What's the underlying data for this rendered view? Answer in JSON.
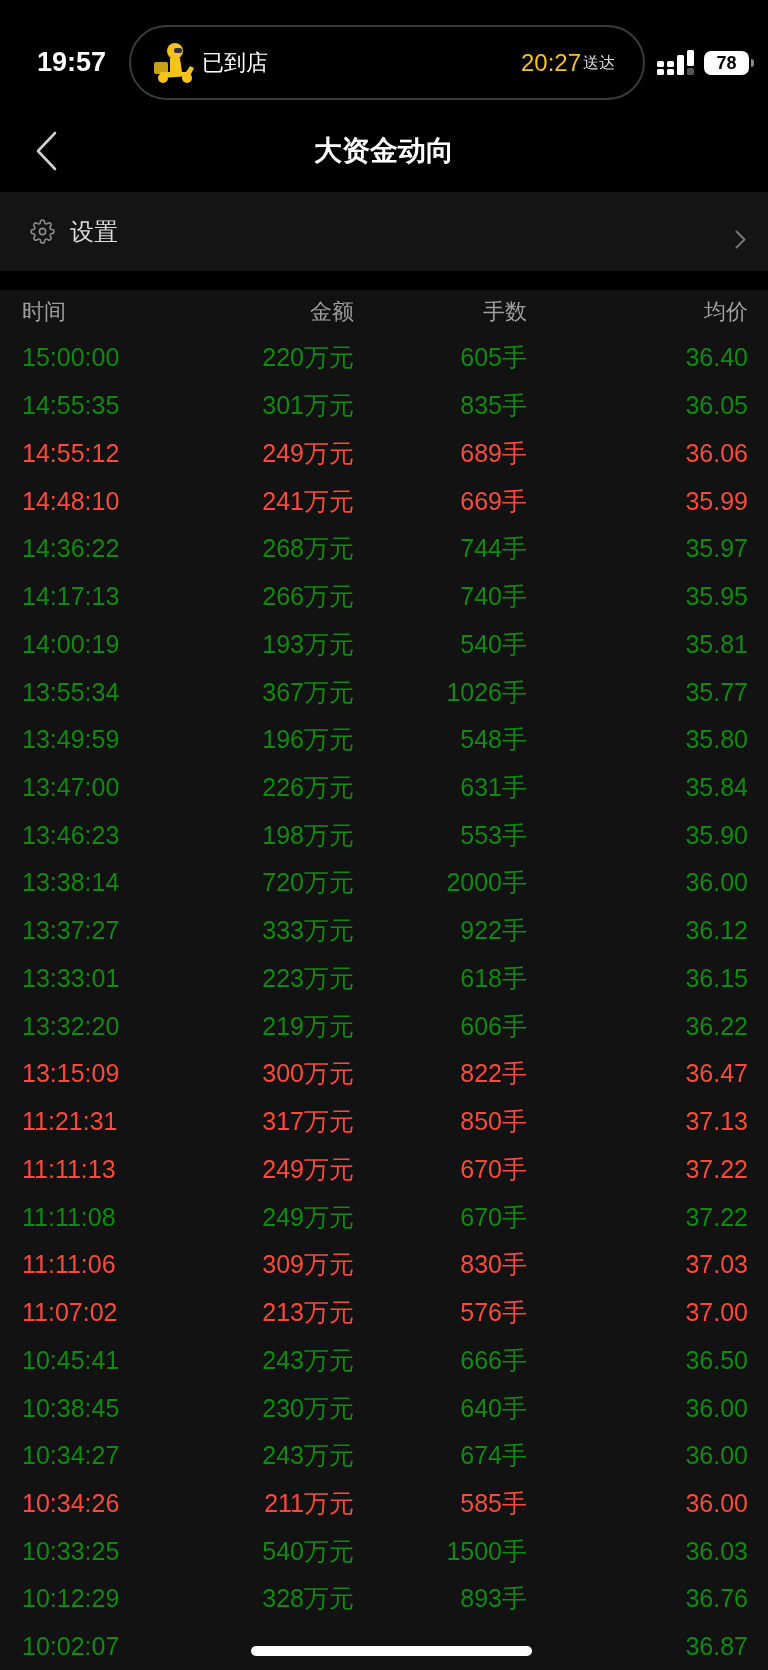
{
  "status_bar": {
    "time": "19:57",
    "live_activity": {
      "status": "已到店",
      "eta": "20:27",
      "eta_label": "送达"
    },
    "battery": "78"
  },
  "nav_bar": {
    "title": "大资金动向"
  },
  "settings_row": {
    "label": "设置"
  },
  "table": {
    "columns": [
      "时间",
      "金额",
      "手数",
      "均价"
    ],
    "rows": [
      {
        "time": "15:00:00",
        "amount": "220万元",
        "lots": "605手",
        "avg_price": "36.40",
        "color": "#108a10"
      },
      {
        "time": "14:55:35",
        "amount": "301万元",
        "lots": "835手",
        "avg_price": "36.05",
        "color": "#108a10"
      },
      {
        "time": "14:55:12",
        "amount": "249万元",
        "lots": "689手",
        "avg_price": "36.06",
        "color": "#fb4a3c"
      },
      {
        "time": "14:48:10",
        "amount": "241万元",
        "lots": "669手",
        "avg_price": "35.99",
        "color": "#fb4a3c"
      },
      {
        "time": "14:36:22",
        "amount": "268万元",
        "lots": "744手",
        "avg_price": "35.97",
        "color": "#108a10"
      },
      {
        "time": "14:17:13",
        "amount": "266万元",
        "lots": "740手",
        "avg_price": "35.95",
        "color": "#108a10"
      },
      {
        "time": "14:00:19",
        "amount": "193万元",
        "lots": "540手",
        "avg_price": "35.81",
        "color": "#108a10"
      },
      {
        "time": "13:55:34",
        "amount": "367万元",
        "lots": "1026手",
        "avg_price": "35.77",
        "color": "#108a10"
      },
      {
        "time": "13:49:59",
        "amount": "196万元",
        "lots": "548手",
        "avg_price": "35.80",
        "color": "#108a10"
      },
      {
        "time": "13:47:00",
        "amount": "226万元",
        "lots": "631手",
        "avg_price": "35.84",
        "color": "#108a10"
      },
      {
        "time": "13:46:23",
        "amount": "198万元",
        "lots": "553手",
        "avg_price": "35.90",
        "color": "#108a10"
      },
      {
        "time": "13:38:14",
        "amount": "720万元",
        "lots": "2000手",
        "avg_price": "36.00",
        "color": "#108a10"
      },
      {
        "time": "13:37:27",
        "amount": "333万元",
        "lots": "922手",
        "avg_price": "36.12",
        "color": "#108a10"
      },
      {
        "time": "13:33:01",
        "amount": "223万元",
        "lots": "618手",
        "avg_price": "36.15",
        "color": "#108a10"
      },
      {
        "time": "13:32:20",
        "amount": "219万元",
        "lots": "606手",
        "avg_price": "36.22",
        "color": "#108a10"
      },
      {
        "time": "13:15:09",
        "amount": "300万元",
        "lots": "822手",
        "avg_price": "36.47",
        "color": "#fb4a3c"
      },
      {
        "time": "11:21:31",
        "amount": "317万元",
        "lots": "850手",
        "avg_price": "37.13",
        "color": "#fb4a3c"
      },
      {
        "time": "11:11:13",
        "amount": "249万元",
        "lots": "670手",
        "avg_price": "37.22",
        "color": "#fb4a3c"
      },
      {
        "time": "11:11:08",
        "amount": "249万元",
        "lots": "670手",
        "avg_price": "37.22",
        "color": "#108a10"
      },
      {
        "time": "11:11:06",
        "amount": "309万元",
        "lots": "830手",
        "avg_price": "37.03",
        "color": "#fb4a3c"
      },
      {
        "time": "11:07:02",
        "amount": "213万元",
        "lots": "576手",
        "avg_price": "37.00",
        "color": "#fb4a3c"
      },
      {
        "time": "10:45:41",
        "amount": "243万元",
        "lots": "666手",
        "avg_price": "36.50",
        "color": "#108a10"
      },
      {
        "time": "10:38:45",
        "amount": "230万元",
        "lots": "640手",
        "avg_price": "36.00",
        "color": "#108a10"
      },
      {
        "time": "10:34:27",
        "amount": "243万元",
        "lots": "674手",
        "avg_price": "36.00",
        "color": "#108a10"
      },
      {
        "time": "10:34:26",
        "amount": "211万元",
        "lots": "585手",
        "avg_price": "36.00",
        "color": "#fb4a3c"
      },
      {
        "time": "10:33:25",
        "amount": "540万元",
        "lots": "1500手",
        "avg_price": "36.03",
        "color": "#108a10"
      },
      {
        "time": "10:12:29",
        "amount": "328万元",
        "lots": "893手",
        "avg_price": "36.76",
        "color": "#108a10"
      },
      {
        "time": "10:02:07",
        "avg_price": "36.87",
        "color": "#108a10"
      }
    ]
  }
}
